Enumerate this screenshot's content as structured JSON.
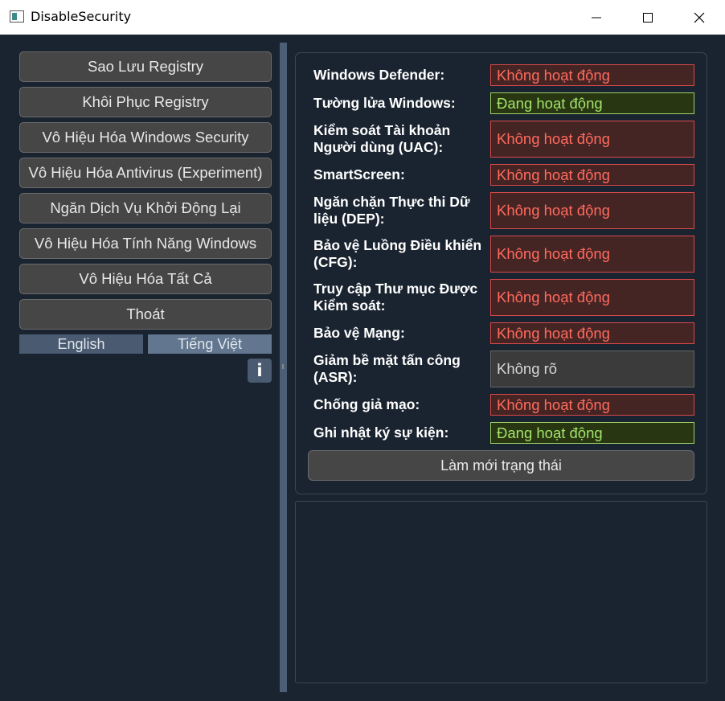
{
  "window": {
    "title": "DisableSecurity"
  },
  "menu": {
    "buttons": [
      "Sao Lưu Registry",
      "Khôi Phục Registry",
      "Vô Hiệu Hóa Windows Security",
      "Vô Hiệu Hóa Antivirus (Experiment)",
      "Ngăn Dịch Vụ Khởi Động Lại",
      "Vô Hiệu Hóa Tính Năng Windows",
      "Vô Hiệu Hóa Tất Cả",
      "Thoát"
    ],
    "lang_english": "English",
    "lang_vietnamese": "Tiếng Việt",
    "info_label": "i"
  },
  "status": {
    "items": [
      {
        "label": "Windows Defender:",
        "value": "Không hoạt động",
        "state": "inactive"
      },
      {
        "label": "Tường lửa Windows:",
        "value": "Đang hoạt động",
        "state": "active"
      },
      {
        "label": "Kiểm soát Tài khoản Người dùng (UAC):",
        "value": "Không hoạt động",
        "state": "inactive"
      },
      {
        "label": "SmartScreen:",
        "value": "Không hoạt động",
        "state": "inactive"
      },
      {
        "label": "Ngăn chặn Thực thi Dữ liệu (DEP):",
        "value": "Không hoạt động",
        "state": "inactive"
      },
      {
        "label": "Bảo vệ Luồng Điều khiển (CFG):",
        "value": "Không hoạt động",
        "state": "inactive"
      },
      {
        "label": "Truy cập Thư mục Được Kiểm soát:",
        "value": "Không hoạt động",
        "state": "inactive"
      },
      {
        "label": "Bảo vệ Mạng:",
        "value": "Không hoạt động",
        "state": "inactive"
      },
      {
        "label": "Giảm bề mặt tấn công (ASR):",
        "value": "Không rõ",
        "state": "unknown"
      },
      {
        "label": "Chống giả mạo:",
        "value": "Không hoạt động",
        "state": "inactive"
      },
      {
        "label": "Ghi nhật ký sự kiện:",
        "value": "Đang hoạt động",
        "state": "active"
      }
    ],
    "refresh_label": "Làm mới trạng thái"
  },
  "colors": {
    "background": "#1a2430",
    "inactive_text": "#ff6b5e",
    "active_text": "#a3e46a"
  }
}
